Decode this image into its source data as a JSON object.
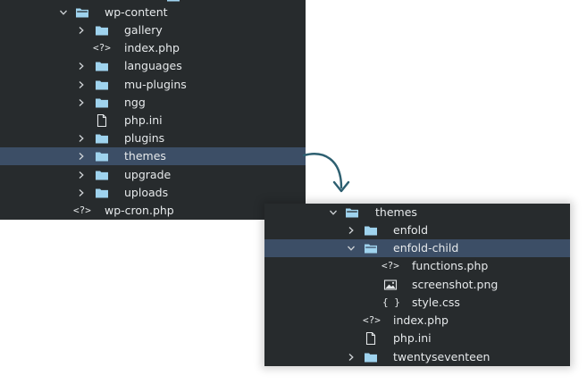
{
  "colors": {
    "panel_bg": "#272b2d",
    "selected_row": "#3c4e66",
    "folder": "#9fd3ee",
    "text": "#e6e9eb",
    "arrow": "#2d5f70"
  },
  "icons": {
    "folder": "folder-icon",
    "folder_open": "folder-open-icon",
    "php_code": "code-file-icon",
    "generic_file": "file-icon",
    "image_file": "image-file-icon",
    "css_braces": "braces-file-icon",
    "chevron_right": "chevron-right-icon",
    "chevron_down": "chevron-down-icon"
  },
  "tree_main": {
    "root_label": "wp-content",
    "items": [
      {
        "label": "gallery"
      },
      {
        "label": "index.php"
      },
      {
        "label": "languages"
      },
      {
        "label": "mu-plugins"
      },
      {
        "label": "ngg"
      },
      {
        "label": "php.ini"
      },
      {
        "label": "plugins"
      },
      {
        "label": "themes"
      },
      {
        "label": "upgrade"
      },
      {
        "label": "uploads"
      }
    ],
    "sibling_label": "wp-cron.php"
  },
  "tree_detail": {
    "root_label": "themes",
    "enfold_label": "enfold",
    "child_label": "enfold-child",
    "child_files": [
      {
        "label": "functions.php"
      },
      {
        "label": "screenshot.png"
      },
      {
        "label": "style.css"
      }
    ],
    "index_label": "index.php",
    "ini_label": "php.ini",
    "twenty_label": "twentyseventeen"
  },
  "glyphs": {
    "php": "<?>",
    "css": "{ }"
  }
}
